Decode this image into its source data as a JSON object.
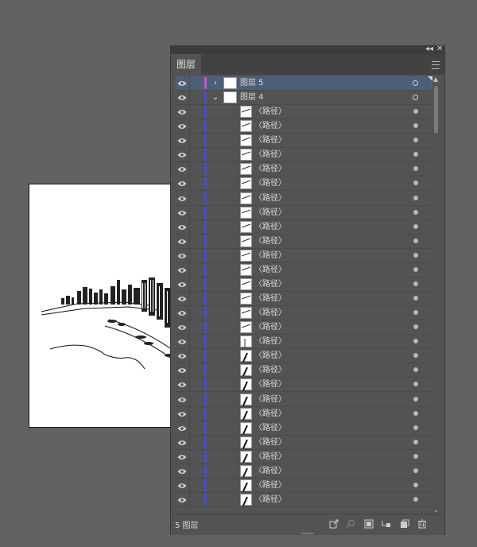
{
  "panel": {
    "title_tab": "图层",
    "collapse_glyph": "◂◂",
    "close_glyph": "✕",
    "status": "5 图层"
  },
  "colors": {
    "background": "#616161",
    "panel_bg": "#535353",
    "selected_row": "#4b6078",
    "layer5_color": "#d24fd2",
    "layer4_color": "#4a4ad6"
  },
  "layers": [
    {
      "name": "图层 5",
      "expander": "›",
      "selected": true,
      "target": "hollow",
      "color": "#d24fd2"
    },
    {
      "name": "图层 4",
      "expander": "⌄",
      "selected": false,
      "target": "hollow",
      "color": "#4a4ad6"
    }
  ],
  "paths": [
    "〈路径〉",
    "〈路径〉",
    "〈路径〉",
    "〈路径〉",
    "〈路径〉",
    "〈路径〉",
    "〈路径〉",
    "〈路径〉",
    "〈路径〉",
    "〈路径〉",
    "〈路径〉",
    "〈路径〉",
    "〈路径〉",
    "〈路径〉",
    "〈路径〉",
    "〈路径〉",
    "〈路径〉",
    "〈路径〉",
    "〈路径〉",
    "〈路径〉",
    "〈路径〉",
    "〈路径〉",
    "〈路径〉",
    "〈路径〉",
    "〈路径〉",
    "〈路径〉",
    "〈路径〉",
    "〈路径〉"
  ],
  "bottom_icons": [
    "export-icon",
    "search-icon",
    "clipping-mask-icon",
    "new-sublayer-icon",
    "new-layer-icon",
    "trash-icon"
  ]
}
